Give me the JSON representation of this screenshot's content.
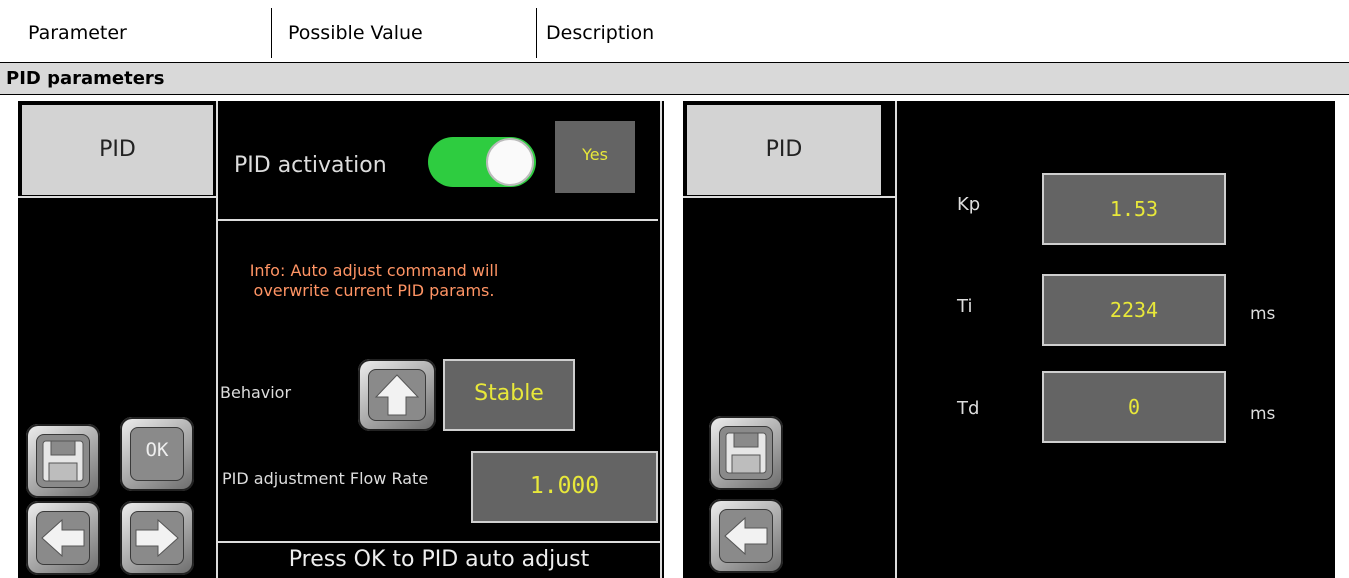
{
  "table": {
    "headers": [
      "Parameter",
      "Possible Value",
      "Description"
    ],
    "section": "PID parameters"
  },
  "left_panel": {
    "tab": "PID",
    "activation_label": "PID activation",
    "activation_value": "Yes",
    "toggle_on": true,
    "info": "Info: Auto adjust command will overwrite current PID params.",
    "behavior_label": "Behavior",
    "behavior_value": "Stable",
    "flow_label": "PID adjustment Flow Rate",
    "flow_value": "1.000",
    "ok_label": "OK",
    "auto_adjust": "Press OK to PID auto adjust"
  },
  "right_panel": {
    "tab": "PID",
    "params": [
      {
        "label": "Kp",
        "value": "1.53",
        "unit": ""
      },
      {
        "label": "Ti",
        "value": "2234",
        "unit": "ms"
      },
      {
        "label": "Td",
        "value": "0",
        "unit": "ms"
      }
    ]
  },
  "colors": {
    "panel_bg": "#000000",
    "tab_bg": "#d3d3d3",
    "value_text": "#e8e83a",
    "info_text": "#ff9464",
    "toggle_on": "#2ecc40"
  }
}
